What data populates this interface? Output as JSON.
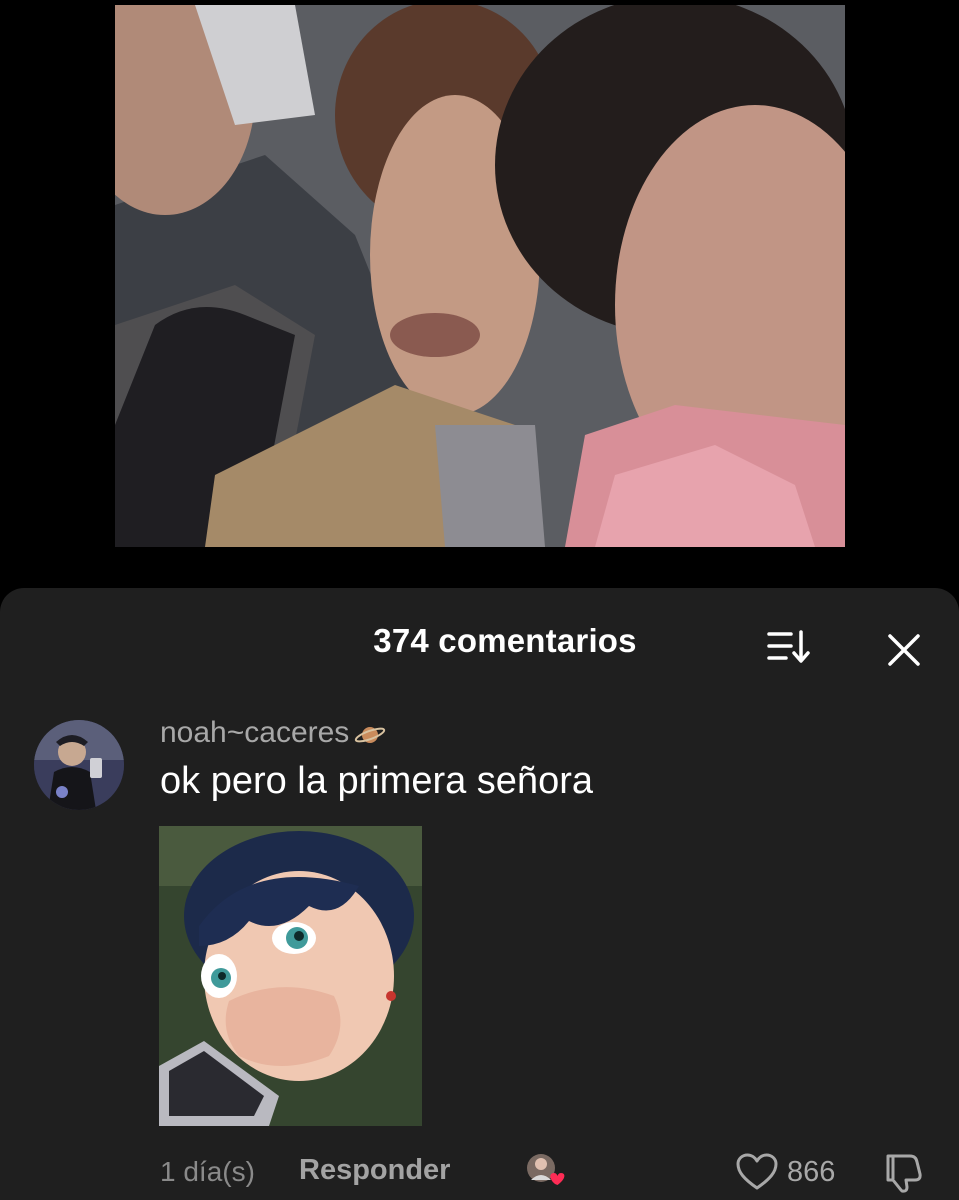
{
  "colors": {
    "sheet_background": "#1f1f1f",
    "primary_text": "#ffffff",
    "secondary_text": "#a8a8a8",
    "heart_badge": "#fe2c55"
  },
  "video": {
    "icon": "video-frame"
  },
  "header": {
    "title": "374 comentarios",
    "sort_icon": "sort-icon",
    "close_icon": "close-icon"
  },
  "comment": {
    "username": "noah~caceres",
    "username_emoji_icon": "ringed-planet-icon",
    "text": "ok pero la primera señora",
    "image_icon": "animated-girl-gif",
    "timestamp": "1 día(s)",
    "reply_label": "Responder",
    "creator_liked_icon": "creator-liked-heart-icon",
    "like_icon": "heart-outline-icon",
    "like_count": "866",
    "dislike_icon": "thumbs-down-icon"
  }
}
